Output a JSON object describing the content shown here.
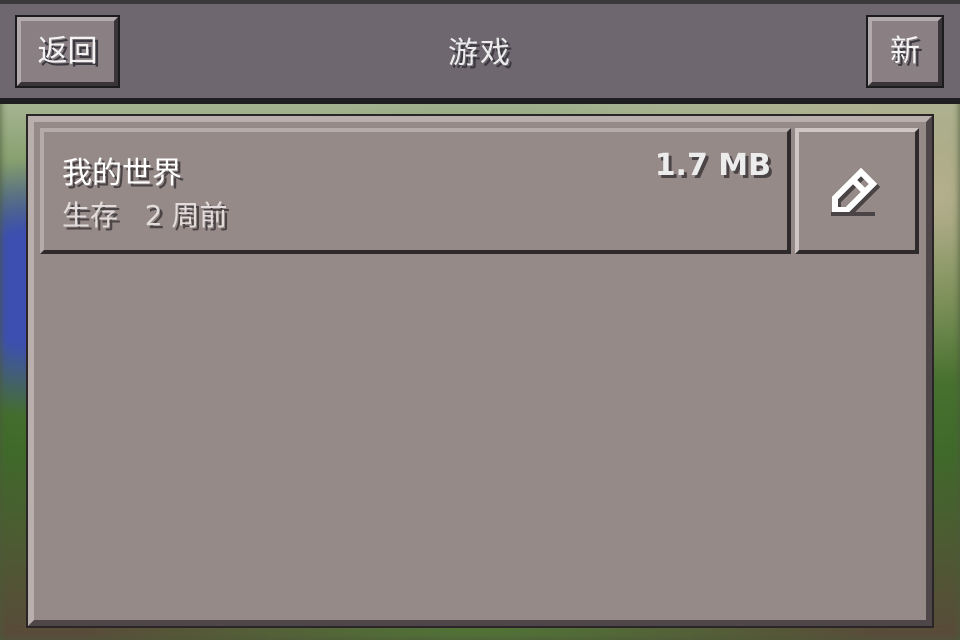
{
  "header": {
    "title": "游戏",
    "back_label": "返回",
    "new_label": "新"
  },
  "worlds": [
    {
      "name": "我的世界",
      "size": "1.7 MB",
      "mode": "生存",
      "last_played": "2 周前",
      "edit_icon": "pencil-icon"
    }
  ],
  "colors": {
    "header_bg": "#6e6770",
    "panel_bg": "#958a87",
    "text": "#ffffff"
  }
}
